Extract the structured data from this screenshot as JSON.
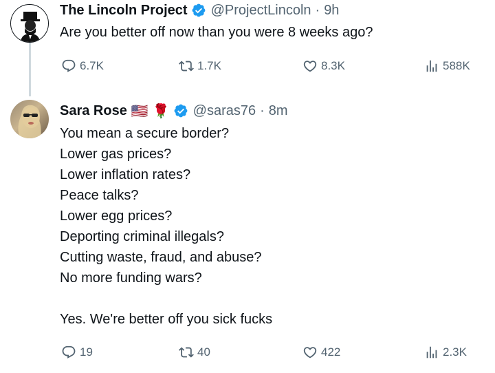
{
  "tweets": [
    {
      "author_name": "The Lincoln Project",
      "handle": "@ProjectLincoln",
      "separator": "·",
      "time": "9h",
      "text": "Are you better off now than you were 8 weeks ago?",
      "replies": "6.7K",
      "retweets": "1.7K",
      "likes": "8.3K",
      "views": "588K"
    },
    {
      "author_name": "Sara Rose",
      "name_emoji_flag": "🇺🇸",
      "name_emoji_rose": "🌹",
      "handle": "@saras76",
      "separator": "·",
      "time": "8m",
      "text": "You mean a secure border?\nLower gas prices?\nLower inflation rates?\nPeace talks?\nLower egg prices?\nDeporting criminal illegals?\nCutting waste, fraud, and abuse?\nNo more funding wars?\n\nYes. We're better off you sick fucks",
      "replies": "19",
      "retweets": "40",
      "likes": "422",
      "views": "2.3K"
    }
  ],
  "colors": {
    "verified": "#1d9bf0",
    "muted": "#536471",
    "text": "#0f1419",
    "thread_line": "#cfd9de"
  },
  "icons": [
    "reply-icon",
    "retweet-icon",
    "like-icon",
    "views-icon",
    "verified-badge-icon"
  ]
}
